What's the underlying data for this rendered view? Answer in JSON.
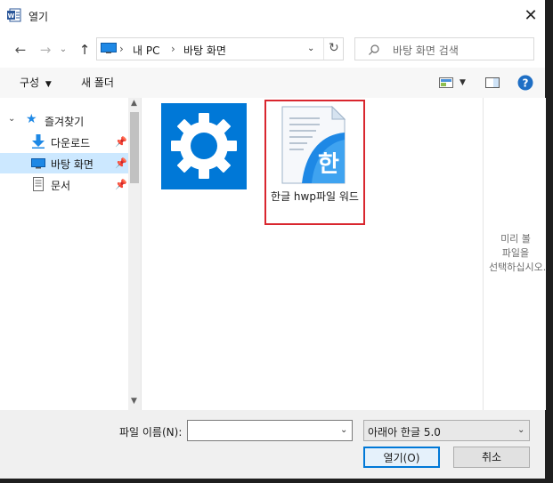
{
  "window": {
    "title": "열기"
  },
  "nav": {
    "path": [
      "내 PC",
      "바탕 화면"
    ],
    "separator": "›",
    "search_placeholder": "바탕 화면 검색"
  },
  "toolbar": {
    "organize": "구성",
    "new_folder": "새 폴더"
  },
  "sidebar": {
    "items": [
      {
        "label": "즐겨찾기",
        "icon": "star-icon"
      },
      {
        "label": "다운로드",
        "icon": "download-arrow-icon"
      },
      {
        "label": "바탕 화면",
        "icon": "desktop-icon",
        "selected": true
      },
      {
        "label": "문서",
        "icon": "document-icon"
      }
    ]
  },
  "files": [
    {
      "name": "",
      "icon": "gear-icon"
    },
    {
      "name": "한글 hwp파일 워드",
      "icon": "hwp-document-icon",
      "selected": true
    }
  ],
  "preview": {
    "message": "미리 볼 파일을 선택하십시오."
  },
  "bottom": {
    "filename_label": "파일 이름(N):",
    "filename_value": "",
    "filetype": "아래아 한글 5.0",
    "open_button": "열기(O)",
    "cancel_button": "취소"
  },
  "colors": {
    "accent": "#0078d7",
    "selection": "#cce8ff",
    "highlight_border": "#d9262e",
    "gear_tile": "#0078d7"
  }
}
